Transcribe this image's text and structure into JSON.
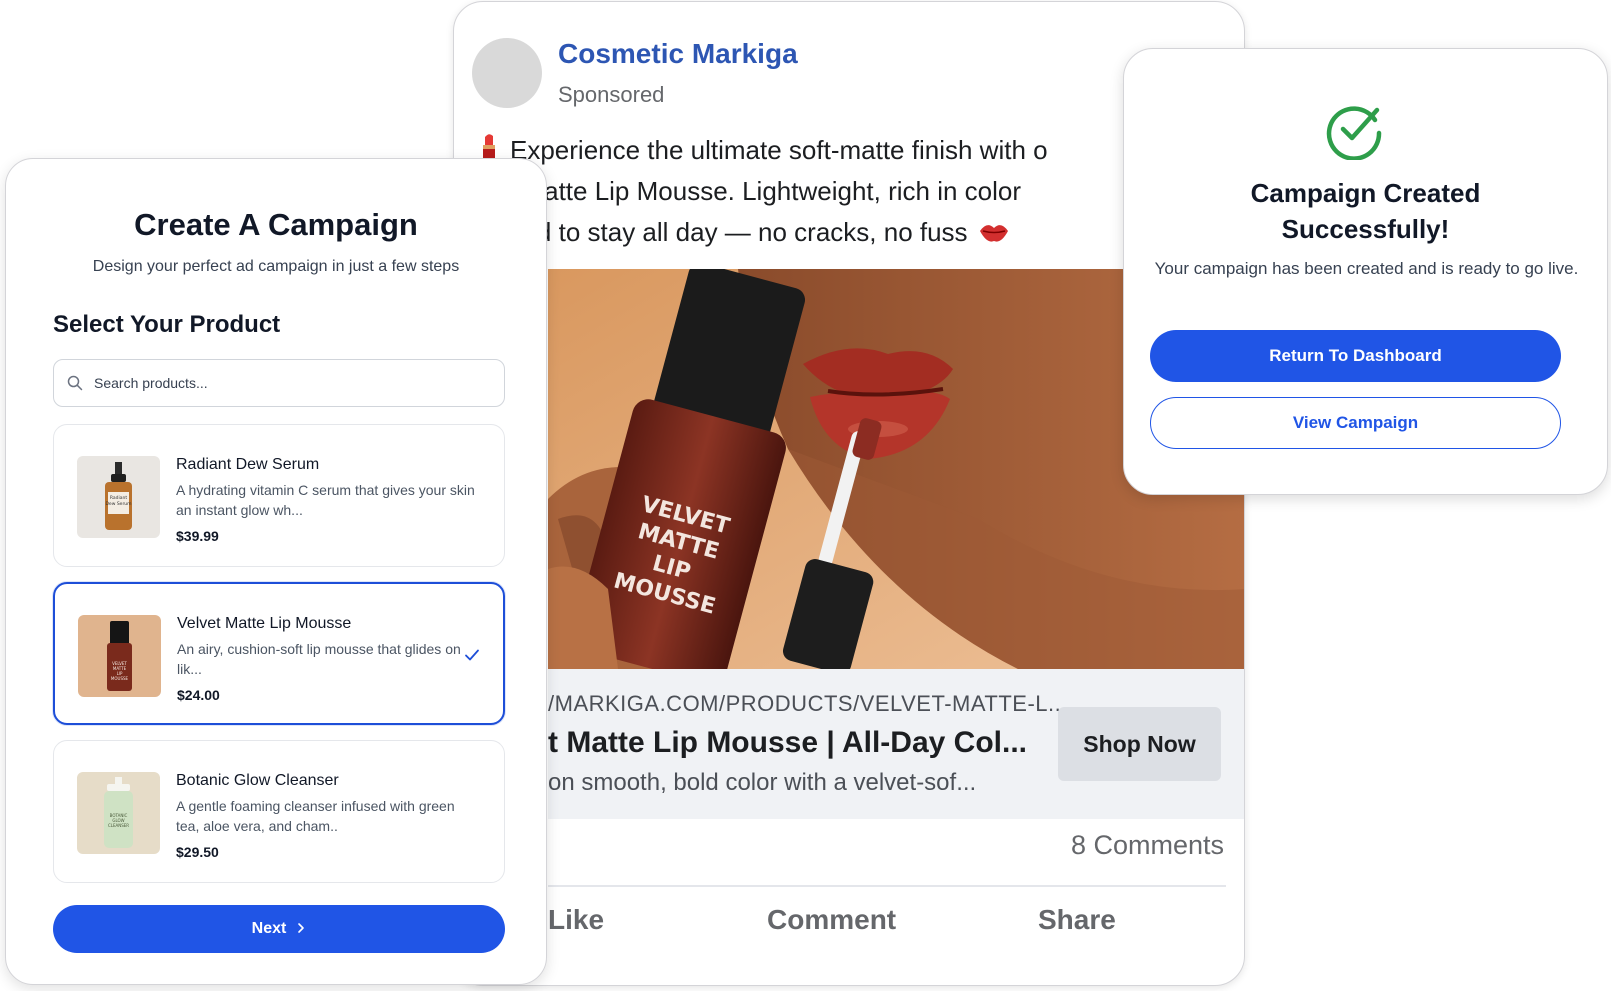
{
  "ad_preview": {
    "page_name": "Cosmetic Markiga",
    "sponsored": "Sponsored",
    "text_lines": [
      "Experience the ultimate soft-matte finish with o",
      "t Matte Lip Mousse. Lightweight, rich in color",
      "ned to stay all day — no cracks, no fuss"
    ],
    "image_product_label": [
      "VELVET",
      "MATTE",
      "LIP",
      "MOUSSE"
    ],
    "link_url": "/MARKIGA.COM/PRODUCTS/VELVET-MATTE-L...",
    "link_title": "t Matte Lip Mousse | All-Day Col...",
    "link_description": "on smooth, bold color with a velvet-sof...",
    "cta_label": "Shop Now",
    "comments": "8 Comments",
    "actions": {
      "like": "Like",
      "comment": "Comment",
      "share": "Share"
    },
    "colors": {
      "page_name": "#2d56b3",
      "lipstick_emoji": "#c62828"
    }
  },
  "campaign": {
    "title": "Create A Campaign",
    "subtitle": "Design your perfect ad campaign in just a few steps",
    "section_title": "Select Your Product",
    "search": {
      "placeholder": "Search products...",
      "icon": "search-icon"
    },
    "products": [
      {
        "name": "Radiant Dew Serum",
        "description": "A hydrating vitamin C serum that gives your skin an instant glow wh...",
        "price": "$39.99",
        "thumb_label": [
          "Radiant",
          "Dew Serum"
        ],
        "selected": false
      },
      {
        "name": "Velvet Matte Lip Mousse",
        "description": "An airy, cushion-soft lip mousse that glides on lik...",
        "price": "$24.00",
        "thumb_label": [
          "VELVET",
          "MATTE",
          "LIP",
          "MOUSSE"
        ],
        "selected": true
      },
      {
        "name": "Botanic Glow Cleanser",
        "description": "A gentle foaming cleanser infused with green tea, aloe vera, and cham..",
        "price": "$29.50",
        "thumb_label": [
          "BOTANIC",
          "GLOW",
          "CLEANSER"
        ],
        "selected": false
      }
    ],
    "next_label": "Next",
    "colors": {
      "primary": "#2055e6",
      "selected_border": "#1d4ed8"
    }
  },
  "success": {
    "title_line1": "Campaign Created",
    "title_line2": "Successfully!",
    "message": "Your campaign has been created and is ready to go live.",
    "primary_button": "Return To Dashboard",
    "secondary_button": "View Campaign",
    "icon": "check-circle-icon",
    "colors": {
      "icon": "#2e9e4a",
      "primary": "#2055e6"
    }
  }
}
